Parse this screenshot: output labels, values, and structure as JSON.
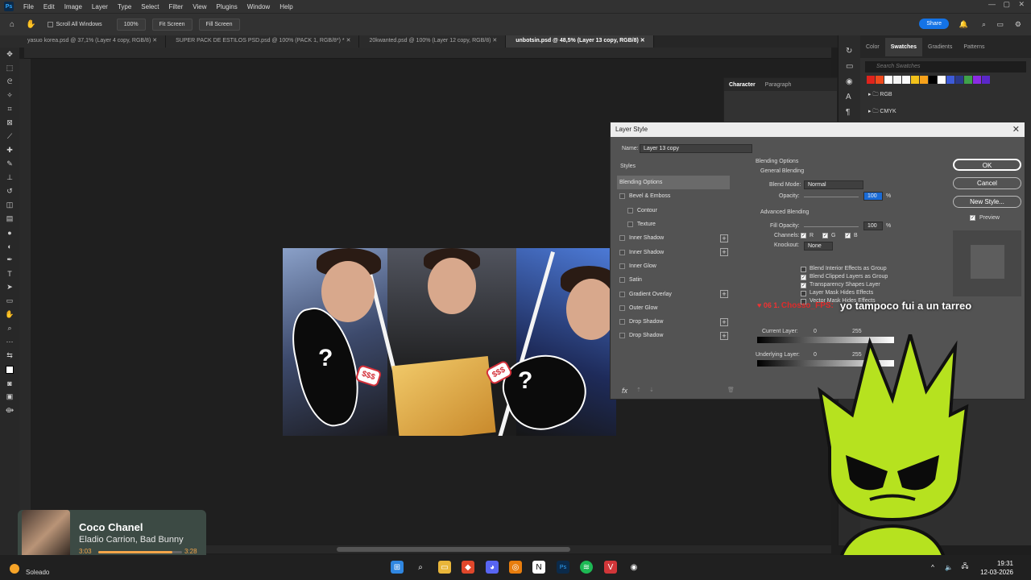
{
  "app": {
    "logo": "Ps"
  },
  "menu": [
    "File",
    "Edit",
    "Image",
    "Layer",
    "Type",
    "Select",
    "Filter",
    "View",
    "Plugins",
    "Window",
    "Help"
  ],
  "options": {
    "scroll_all": "Scroll All Windows",
    "zoom": "100%",
    "fit_screen_1": "Fit Screen",
    "fit_screen_2": "Fill Screen",
    "share": "Share"
  },
  "tabs": [
    {
      "label": "yasuo korea.psd @ 37,1% (Layer 4 copy, RGB/8)"
    },
    {
      "label": "SUPER PACK DE ESTILOS PSD.psd @ 100% (PACK 1, RGB/8*) *"
    },
    {
      "label": "20kwanted.psd @ 100% (Layer 12 copy, RGB/8)"
    },
    {
      "label": "unbotsin.psd @ 48,5% (Layer 13 copy, RGB/8)"
    }
  ],
  "panel": {
    "tabs": [
      "Color",
      "Swatches",
      "Gradients",
      "Patterns"
    ],
    "search_placeholder": "Search Swatches",
    "folders": [
      "RGB",
      "CMYK"
    ],
    "swatch_colors": [
      "#e0231c",
      "#f04a1d",
      "#ffffff",
      "#f5f5f5",
      "#fbfbfb",
      "#f2c21b",
      "#f7a21b",
      "#000000",
      "#ffffff",
      "#3d5bd9",
      "#2b3a8c",
      "#3fa14a",
      "#8a2be2",
      "#5a27c9"
    ]
  },
  "character": {
    "tab1": "Character",
    "tab2": "Paragraph"
  },
  "dialog": {
    "title": "Layer Style",
    "name_label": "Name:",
    "name_value": "Layer 13 copy",
    "styles_header": "Styles",
    "styles": [
      {
        "label": "Blending Options",
        "checkbox": false,
        "plus": false,
        "indent": false,
        "selected": true
      },
      {
        "label": "Bevel & Emboss",
        "checkbox": true,
        "plus": false,
        "indent": false
      },
      {
        "label": "Contour",
        "checkbox": true,
        "plus": false,
        "indent": true
      },
      {
        "label": "Texture",
        "checkbox": true,
        "plus": false,
        "indent": true
      },
      {
        "label": "Inner Shadow",
        "checkbox": true,
        "plus": true,
        "indent": false
      },
      {
        "label": "Inner Shadow",
        "checkbox": true,
        "plus": true,
        "indent": false
      },
      {
        "label": "Inner Glow",
        "checkbox": true,
        "plus": false,
        "indent": false
      },
      {
        "label": "Satin",
        "checkbox": true,
        "plus": false,
        "indent": false
      },
      {
        "label": "Gradient Overlay",
        "checkbox": true,
        "plus": true,
        "indent": false
      },
      {
        "label": "Outer Glow",
        "checkbox": true,
        "plus": false,
        "indent": false
      },
      {
        "label": "Drop Shadow",
        "checkbox": true,
        "plus": true,
        "indent": false
      },
      {
        "label": "Drop Shadow",
        "checkbox": true,
        "plus": true,
        "indent": false
      }
    ],
    "blending_options": "Blending Options",
    "general_blending": "General Blending",
    "blend_mode_label": "Blend Mode:",
    "blend_mode_value": "Normal",
    "opacity_label": "Opacity:",
    "opacity_value": "100",
    "percent": "%",
    "advanced_blending": "Advanced Blending",
    "fill_opacity_label": "Fill Opacity:",
    "fill_opacity_value": "100",
    "channels_label": "Channels:",
    "channel_r": "R",
    "channel_g": "G",
    "channel_b": "B",
    "knockout_label": "Knockout:",
    "knockout_value": "None",
    "adv_checks": [
      {
        "label": "Blend Interior Effects as Group",
        "checked": false
      },
      {
        "label": "Blend Clipped Layers as Group",
        "checked": true
      },
      {
        "label": "Transparency Shapes Layer",
        "checked": true
      },
      {
        "label": "Layer Mask Hides Effects",
        "checked": false
      },
      {
        "label": "Vector Mask Hides Effects",
        "checked": false
      }
    ],
    "current_layer": "Current Layer:",
    "cl_min": "0",
    "cl_max": "255",
    "underlying_layer": "Underlying Layer:",
    "ul_min": "0",
    "ul_max": "255",
    "ok": "OK",
    "cancel": "Cancel",
    "new_style": "New Style...",
    "preview": "Preview",
    "fx": "fx"
  },
  "chat": {
    "badges": "♥ 06 1.",
    "user": "Chosso_FPS:",
    "message": "yo tampoco fui a un tarreo"
  },
  "music": {
    "title": "Coco Chanel",
    "artist": "Eladio Carrion, Bad Bunny",
    "elapsed": "3:03",
    "total": "3:28",
    "progress": 0.88
  },
  "weather": {
    "text": "Soleado"
  },
  "clock": {
    "time": "19:31",
    "date": "12-03-2026"
  }
}
